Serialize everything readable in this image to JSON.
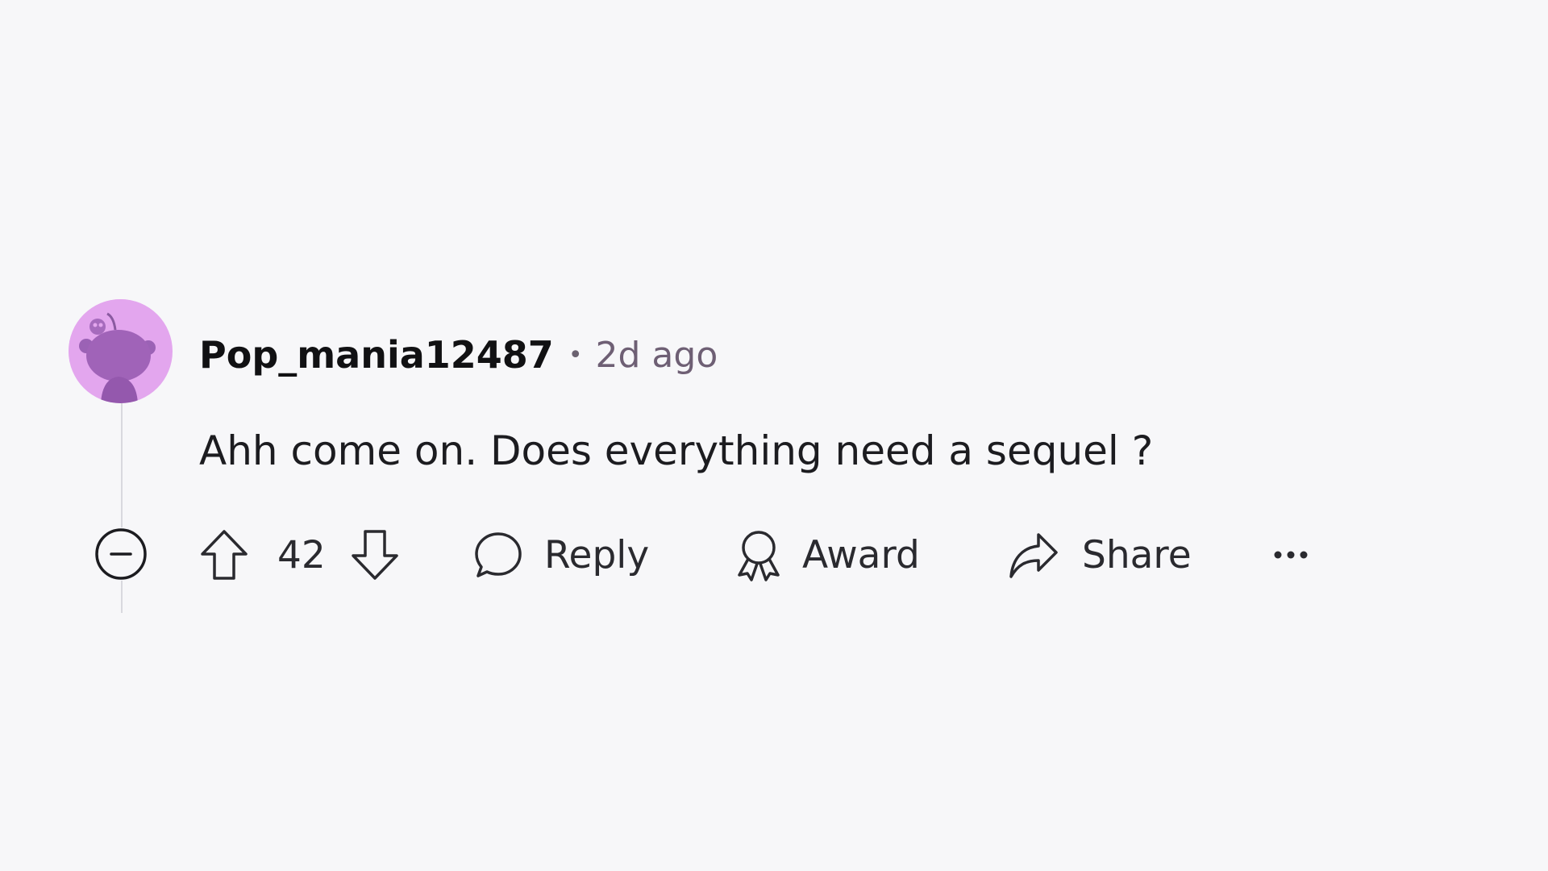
{
  "comment": {
    "username": "Pop_mania12487",
    "separator": "•",
    "timestamp": "2d ago",
    "text": "Ahh come on. Does everything need a sequel ?",
    "avatar_color": "#e3a6ee",
    "avatar_icon": "snoo-avatar-icon"
  },
  "actions": {
    "collapse_icon": "minus-circle-icon",
    "upvote_icon": "arrow-up-icon",
    "vote_count": "42",
    "downvote_icon": "arrow-down-icon",
    "reply_label": "Reply",
    "reply_icon": "speech-bubble-icon",
    "award_label": "Award",
    "award_icon": "ribbon-icon",
    "share_label": "Share",
    "share_icon": "share-arrow-icon",
    "more_icon": "more-dots-icon"
  },
  "colors": {
    "background": "#f7f7f9",
    "text": "#1c1c20",
    "meta": "#6e5f74"
  }
}
